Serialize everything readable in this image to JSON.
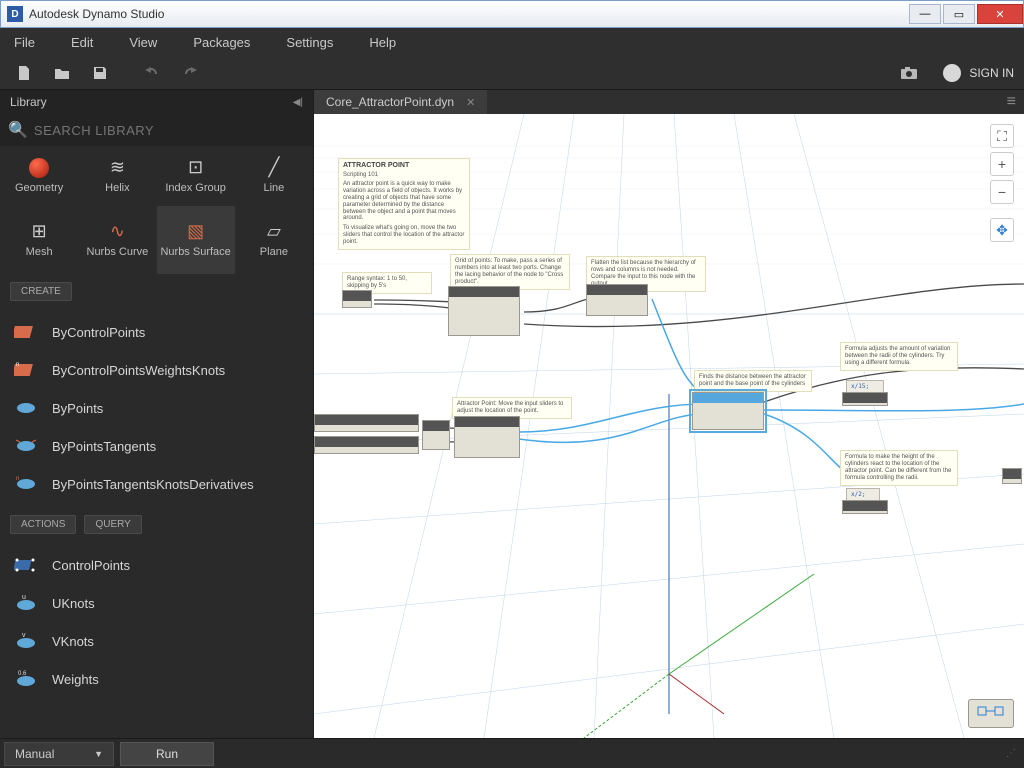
{
  "window": {
    "title": "Autodesk Dynamo Studio"
  },
  "menu": {
    "file": "File",
    "edit": "Edit",
    "view": "View",
    "packages": "Packages",
    "settings": "Settings",
    "help": "Help"
  },
  "toolbar": {
    "signin": "SIGN IN"
  },
  "library": {
    "title": "Library",
    "search_placeholder": "SEARCH LIBRARY",
    "categories_row1": [
      {
        "label": "Geometry"
      },
      {
        "label": "Helix"
      },
      {
        "label": "Index Group"
      },
      {
        "label": "Line"
      }
    ],
    "categories_row2": [
      {
        "label": "Mesh"
      },
      {
        "label": "Nurbs Curve"
      },
      {
        "label": "Nurbs Surface",
        "selected": true
      },
      {
        "label": "Plane"
      }
    ],
    "section_create": "CREATE",
    "create_methods": [
      "ByControlPoints",
      "ByControlPointsWeightsKnots",
      "ByPoints",
      "ByPointsTangents",
      "ByPointsTangentsKnotsDerivatives"
    ],
    "section_actions": "ACTIONS",
    "section_query": "QUERY",
    "query_methods": [
      {
        "label": "ControlPoints",
        "badge": ""
      },
      {
        "label": "UKnots",
        "badge": "u"
      },
      {
        "label": "VKnots",
        "badge": "v"
      },
      {
        "label": "Weights",
        "badge": "0.6"
      }
    ]
  },
  "tab": {
    "name": "Core_AttractorPoint.dyn"
  },
  "notes": {
    "main": {
      "title": "ATTRACTOR POINT",
      "sub": "Scripting 101",
      "p1": "An attractor point is a quick way to make variation across a field of objects. It works by creating a grid of objects that have some parameter determined by the distance between the object and a point that moves around.",
      "p2": "To visualize what's going on, move the two sliders that control the location of the attractor point."
    },
    "range": "Range syntax: 1 to 50, skipping by 5's",
    "grid": "Grid of points:\nTo make, pass a series of numbers into at least two ports. Change the lacing behavior of the node to \"Cross product\".",
    "flatten": "Flatten the list because the hierarchy of rows and columns is not needed. Compare the input to this node with the output.",
    "attractor": "Attractor Point: Move the input sliders to adjust the location of the point.",
    "distance": "Finds the distance between the attractor point and the base point of the cylinders",
    "formula1": "Formula adjusts the amount of variation between the radii of the cylinders. Try using a different formula.",
    "formula2": "Formula to make the height of the cylinders react to the location of the attractor point. Can be different from the formula controlling the radii.",
    "code1": "x/15;",
    "code2": "x/2;"
  },
  "status": {
    "mode": "Manual",
    "run": "Run"
  }
}
